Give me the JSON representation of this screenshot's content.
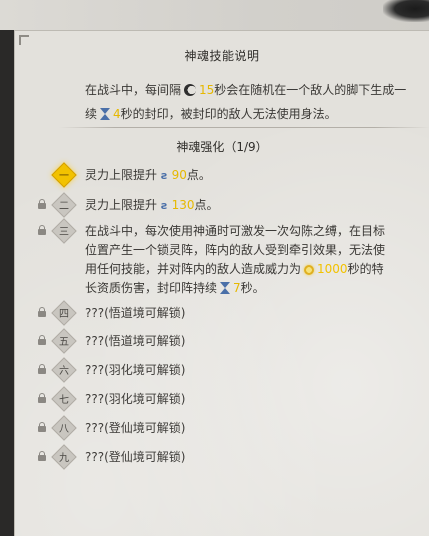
{
  "panel": {
    "title": "神魂技能说明",
    "description": {
      "part1": "在战斗中，每间隔",
      "interval": "15",
      "part2": "秒会在随机在一个敌人的脚下生成一",
      "part3": "续",
      "duration": "4",
      "part4": "秒的封印，被封印的敌人无法使用身法。"
    },
    "subtitle": "神魂强化（1/9）"
  },
  "tiers": [
    {
      "numeral": "一",
      "active": true,
      "pre": "灵力上限提升",
      "value": "90",
      "post": "点。"
    },
    {
      "numeral": "二",
      "active": false,
      "pre": "灵力上限提升",
      "value": "130",
      "post": "点。"
    },
    {
      "numeral": "三",
      "active": false,
      "line1": "在战斗中，每次使用神通时可激发一次勾陈之缚，在目标",
      "line2": "位置产生一个锁灵阵，阵内的敌人受到牵引效果，无法使",
      "line3_pre": "用任何技能，并对阵内的敌人造成威力为",
      "power": "1000",
      "line3_post": "秒的特",
      "line4_pre": "长资质伤害，封印阵持续",
      "seal": "7",
      "line4_post": "秒。"
    },
    {
      "numeral": "四",
      "active": false,
      "text": "???(悟道境可解锁)"
    },
    {
      "numeral": "五",
      "active": false,
      "text": "???(悟道境可解锁)"
    },
    {
      "numeral": "六",
      "active": false,
      "text": "???(羽化境可解锁)"
    },
    {
      "numeral": "七",
      "active": false,
      "text": "???(羽化境可解锁)"
    },
    {
      "numeral": "八",
      "active": false,
      "text": "???(登仙境可解锁)"
    },
    {
      "numeral": "九",
      "active": false,
      "text": "???(登仙境可解锁)"
    }
  ],
  "icons": {
    "interval": "moon-icon",
    "duration": "hourglass-icon",
    "spirit": "spirit-s-icon",
    "power": "sun-icon",
    "lock": "lock-icon"
  },
  "colors": {
    "highlight": "#f2c200",
    "panel_bg": "#e3e1dc",
    "icon_blue": "#4a6fa8"
  }
}
